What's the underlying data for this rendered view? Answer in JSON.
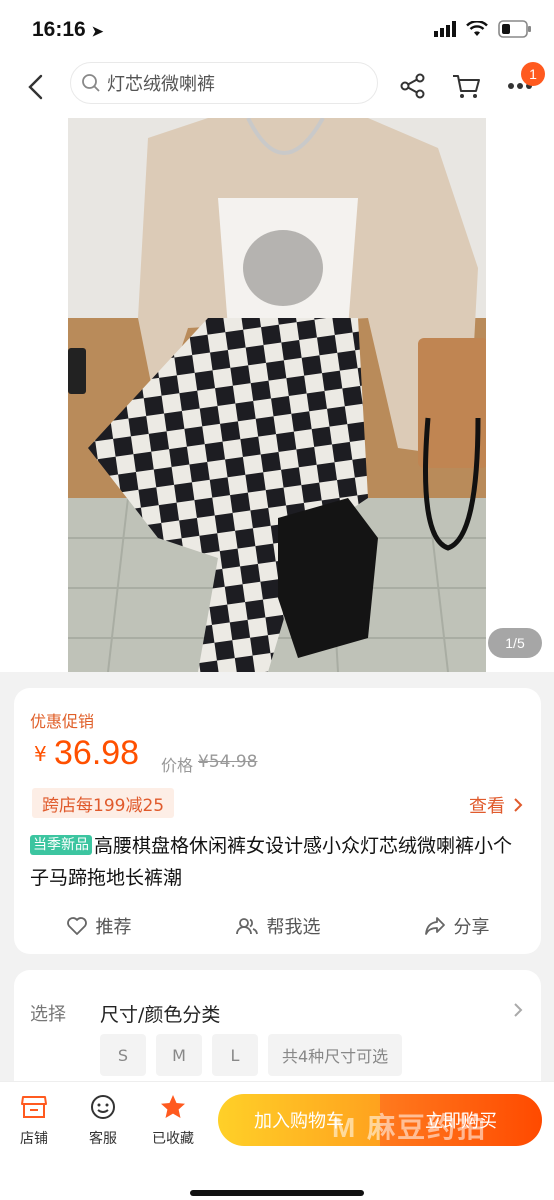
{
  "status_bar": {
    "time": "16:16"
  },
  "search": {
    "query": "灯芯绒微喇裤"
  },
  "nav": {
    "cart_badge": "1"
  },
  "gallery": {
    "indicator": "1/5"
  },
  "product": {
    "promo_label": "优惠促销",
    "currency": "¥",
    "price": "36.98",
    "original_label": "价格",
    "original_price": "¥54.98",
    "coupon": "跨店每199减25",
    "see_more": "查看",
    "new_tag": "当季新品",
    "title": "高腰棋盘格休闲裤女设计感小众灯芯绒微喇裤小个子马蹄拖地长裤潮",
    "actions": {
      "recommend": "推荐",
      "help_choose": "帮我选",
      "share": "分享"
    }
  },
  "options": {
    "label": "选择",
    "title": "尺寸/颜色分类",
    "sizes": [
      "S",
      "M",
      "L"
    ],
    "summary": "共4种尺寸可选"
  },
  "bottom": {
    "shop": "店铺",
    "service": "客服",
    "favorited": "已收藏",
    "add_to_cart": "加入购物车",
    "buy_now": "立即购买",
    "watermark": "M 麻豆约拍"
  },
  "colors": {
    "accent": "#ff5000",
    "new_tag": "#3cc5a0"
  }
}
